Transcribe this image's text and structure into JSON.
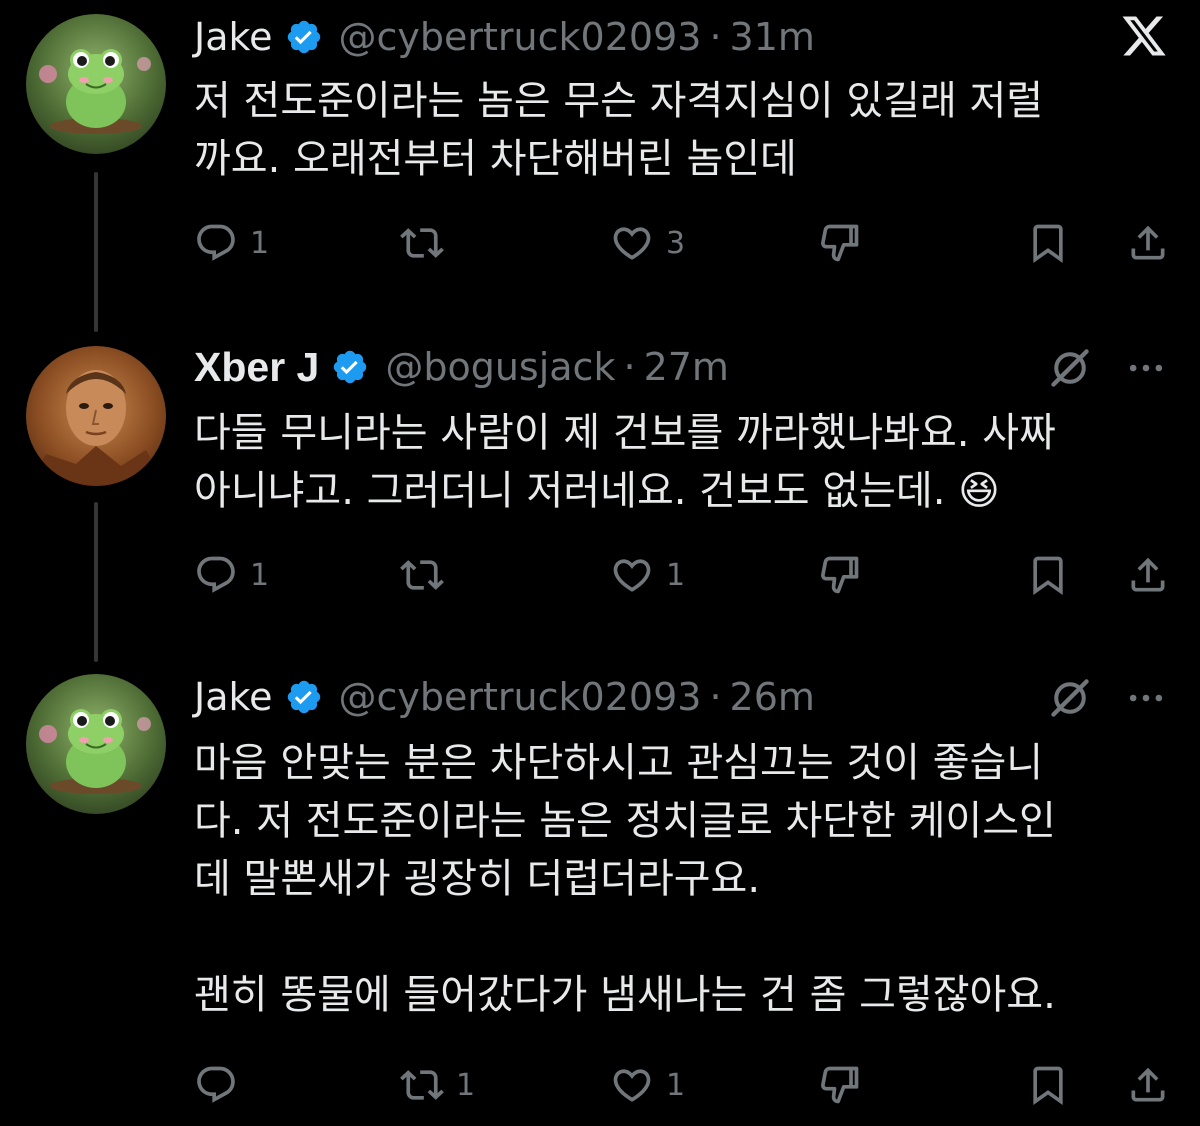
{
  "tweets": [
    {
      "name": "Jake",
      "handle": "@cybertruck02093",
      "separator": "·",
      "time": "31m",
      "text": "저 전도준이라는 놈은 무슨 자격지심이 있길래 저럴\n까요. 오래전부터 차단해버린 놈인데",
      "replies": "1",
      "reposts": "",
      "likes": "3",
      "top_icon": "x-logo-icon"
    },
    {
      "name": "Xber J",
      "handle": "@bogusjack",
      "separator": "·",
      "time": "27m",
      "text": "다들 무니라는 사람이 제 건보를 까라했나봐요. 사짜\n아니냐고. 그러더니 저러네요. 건보도 없는데. 😆",
      "replies": "1",
      "reposts": "",
      "likes": "1",
      "top_icon": "grok-icon"
    },
    {
      "name": "Jake",
      "handle": "@cybertruck02093",
      "separator": "·",
      "time": "26m",
      "text": "마음 안맞는 분은 차단하시고 관심끄는 것이 좋습니\n다. 저 전도준이라는 놈은 정치글로 차단한 케이스인\n데 말뽄새가 굉장히 더럽더라구요.\n\n괜히 똥물에 들어갔다가 냄새나는 건 좀 그렇잖아요.",
      "replies": "",
      "reposts": "1",
      "likes": "1",
      "top_icon": "grok-icon"
    }
  ],
  "colors": {
    "background": "#000000",
    "text": "#e7e9ea",
    "muted": "#71767b",
    "verified": "#1d9bf0",
    "thread_line": "#333639"
  }
}
